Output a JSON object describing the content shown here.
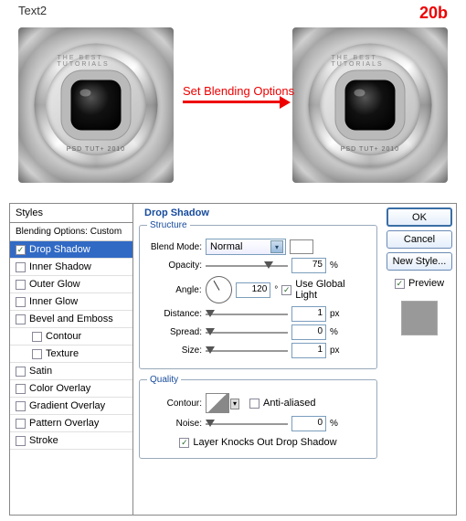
{
  "top": {
    "text2": "Text2",
    "step": "20b",
    "arrow_label": "Set Blending Options",
    "ring_top": "THE BEST TUTORIALS",
    "ring_bottom": "PSD TUT+ 2010"
  },
  "dialog": {
    "styles_header": "Styles",
    "blending_line": "Blending Options: Custom",
    "items": [
      {
        "label": "Drop Shadow",
        "checked": true,
        "active": true
      },
      {
        "label": "Inner Shadow",
        "checked": false
      },
      {
        "label": "Outer Glow",
        "checked": false
      },
      {
        "label": "Inner Glow",
        "checked": false
      },
      {
        "label": "Bevel and Emboss",
        "checked": false
      },
      {
        "label": "Contour",
        "checked": false,
        "indent": true
      },
      {
        "label": "Texture",
        "checked": false,
        "indent": true
      },
      {
        "label": "Satin",
        "checked": false
      },
      {
        "label": "Color Overlay",
        "checked": false
      },
      {
        "label": "Gradient Overlay",
        "checked": false
      },
      {
        "label": "Pattern Overlay",
        "checked": false
      },
      {
        "label": "Stroke",
        "checked": false
      }
    ],
    "title": "Drop Shadow",
    "structure": {
      "legend": "Structure",
      "blend_mode_label": "Blend Mode:",
      "blend_mode_value": "Normal",
      "opacity_label": "Opacity:",
      "opacity_value": "75",
      "opacity_unit": "%",
      "angle_label": "Angle:",
      "angle_value": "120",
      "angle_unit": "°",
      "global_light": "Use Global Light",
      "global_light_checked": true,
      "distance_label": "Distance:",
      "distance_value": "1",
      "distance_unit": "px",
      "spread_label": "Spread:",
      "spread_value": "0",
      "spread_unit": "%",
      "size_label": "Size:",
      "size_value": "1",
      "size_unit": "px"
    },
    "quality": {
      "legend": "Quality",
      "contour_label": "Contour:",
      "anti_aliased": "Anti-aliased",
      "anti_checked": false,
      "noise_label": "Noise:",
      "noise_value": "0",
      "noise_unit": "%",
      "knockout": "Layer Knocks Out Drop Shadow",
      "knockout_checked": true
    },
    "buttons": {
      "ok": "OK",
      "cancel": "Cancel",
      "new_style": "New Style...",
      "preview": "Preview",
      "preview_checked": true
    }
  }
}
